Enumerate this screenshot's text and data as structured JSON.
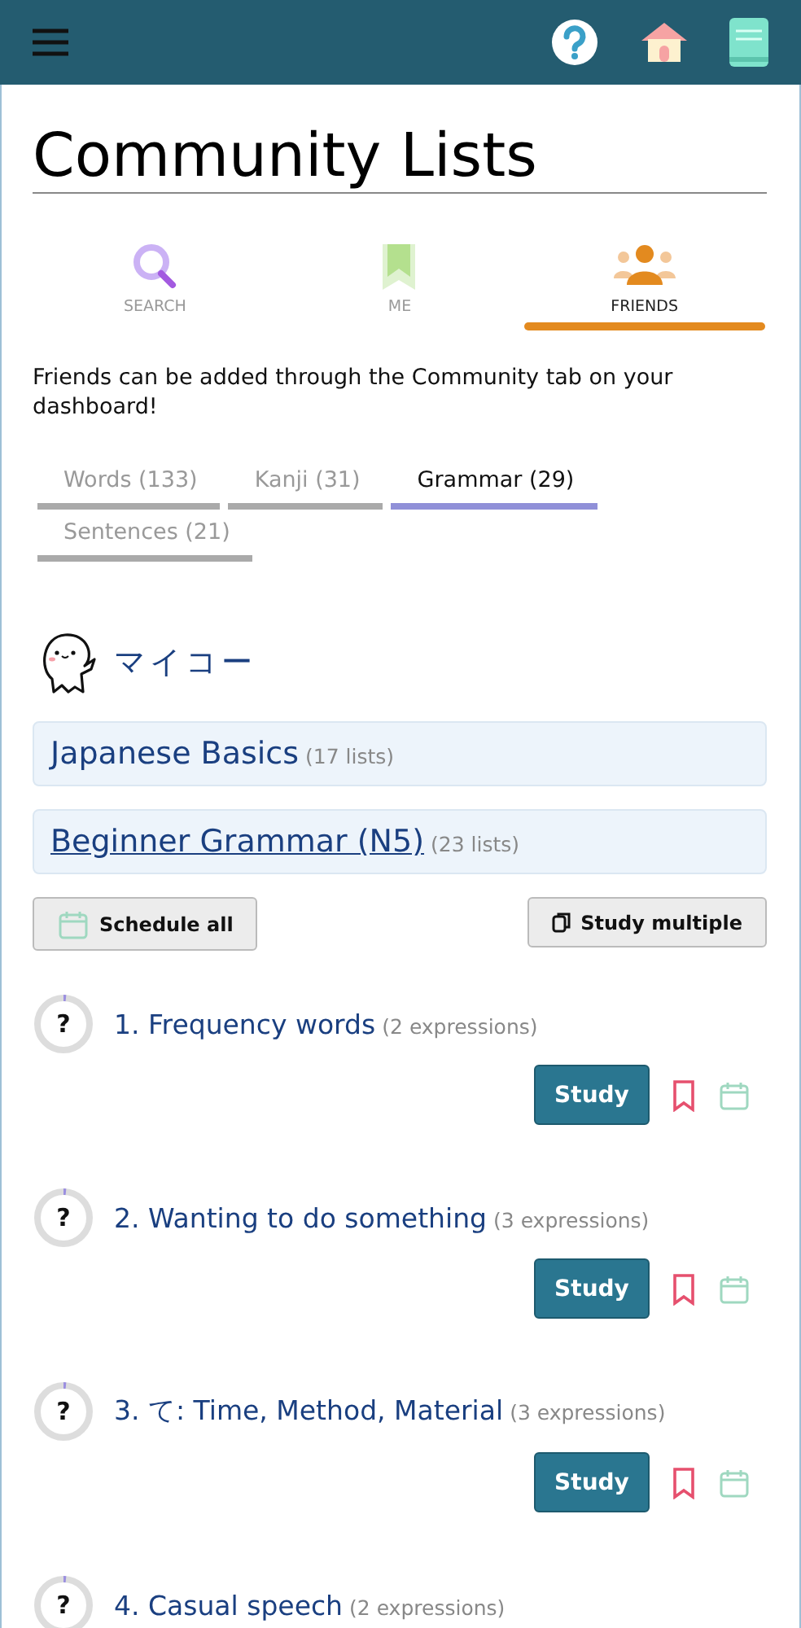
{
  "page_title": "Community Lists",
  "nav_tabs": [
    {
      "kind": "search",
      "label": "SEARCH",
      "selected": false
    },
    {
      "kind": "me",
      "label": "ME",
      "selected": false
    },
    {
      "kind": "friends",
      "label": "FRIENDS",
      "selected": true
    }
  ],
  "notice": "Friends can be added through the Community tab on your dashboard!",
  "category_tabs": [
    {
      "label": "Words (133)",
      "selected": false
    },
    {
      "label": "Kanji (31)",
      "selected": false
    },
    {
      "label": "Grammar (29)",
      "selected": true
    },
    {
      "label": "Sentences (21)",
      "selected": false
    }
  ],
  "user": {
    "name": "マイコー"
  },
  "collections": [
    {
      "title": "Japanese Basics",
      "count": "(17 lists)",
      "underlined": false
    },
    {
      "title": "Beginner Grammar (N5)",
      "count": "(23 lists)",
      "underlined": true
    }
  ],
  "actions": {
    "schedule": "Schedule all",
    "study_multiple": "Study multiple"
  },
  "lists": [
    {
      "mark": "?",
      "title": "1. Frequency words",
      "count": "(2 expressions)",
      "button": "Study"
    },
    {
      "mark": "?",
      "title": "2. Wanting to do something",
      "count": "(3 expressions)",
      "button": "Study"
    },
    {
      "mark": "?",
      "title": "3. て: Time, Method, Material",
      "count": "(3 expressions)",
      "button": "Study"
    },
    {
      "mark": "?",
      "title": "4. Casual speech",
      "count": "(2 expressions)"
    }
  ]
}
